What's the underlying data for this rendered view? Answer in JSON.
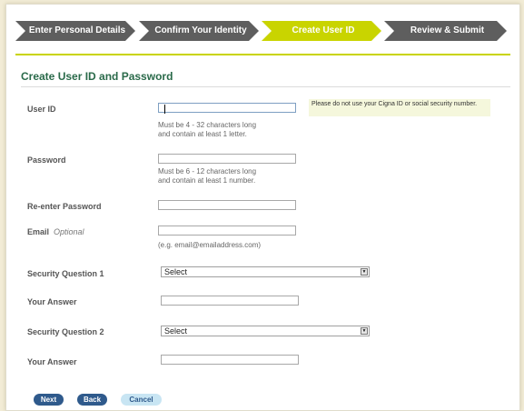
{
  "steps": [
    {
      "label": "Enter Personal Details",
      "active": false
    },
    {
      "label": "Confirm Your Identity",
      "active": false
    },
    {
      "label": "Create User ID",
      "active": true
    },
    {
      "label": "Review & Submit",
      "active": false
    }
  ],
  "section_title": "Create User ID and Password",
  "form": {
    "user_id": {
      "label": "User ID",
      "value": "",
      "hint_line1": "Must be 4 - 32 characters long",
      "hint_line2": "and contain at least 1 letter.",
      "notice": "Please do not use your Cigna ID or social security number."
    },
    "password": {
      "label": "Password",
      "value": "",
      "hint_line1": "Must be 6 - 12 characters long",
      "hint_line2": "and contain at least 1 number."
    },
    "reenter_password": {
      "label": "Re-enter Password",
      "value": ""
    },
    "email": {
      "label": "Email",
      "optional": "Optional",
      "value": "",
      "hint": "(e.g. email@emailaddress.com)"
    },
    "security_question_1": {
      "label": "Security Question 1",
      "selected": "Select"
    },
    "answer_1": {
      "label": "Your Answer",
      "value": ""
    },
    "security_question_2": {
      "label": "Security Question 2",
      "selected": "Select"
    },
    "answer_2": {
      "label": "Your Answer",
      "value": ""
    }
  },
  "buttons": {
    "next": "Next",
    "back": "Back",
    "cancel": "Cancel"
  },
  "colors": {
    "page_background": "#f2ecd6",
    "step_inactive": "#5e5e5e",
    "step_active": "#c9d400",
    "title_green": "#2a6a4a",
    "button_primary": "#2f5a8c",
    "button_secondary": "#c8e5f3",
    "notice_background": "#f5f7dc"
  },
  "icons": {
    "dropdown": "chevron-down-icon"
  }
}
